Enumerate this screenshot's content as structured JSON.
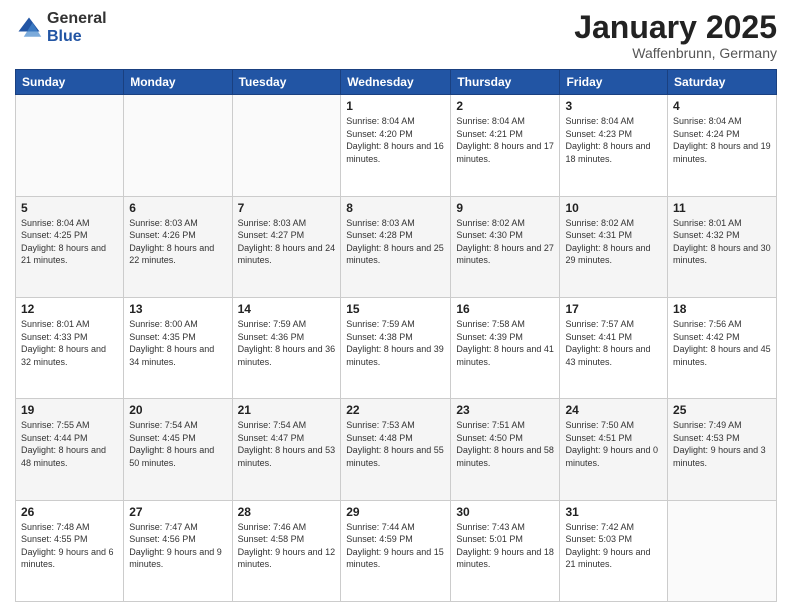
{
  "header": {
    "logo_general": "General",
    "logo_blue": "Blue",
    "month_title": "January 2025",
    "location": "Waffenbrunn, Germany"
  },
  "days_of_week": [
    "Sunday",
    "Monday",
    "Tuesday",
    "Wednesday",
    "Thursday",
    "Friday",
    "Saturday"
  ],
  "weeks": [
    [
      {
        "day": "",
        "info": ""
      },
      {
        "day": "",
        "info": ""
      },
      {
        "day": "",
        "info": ""
      },
      {
        "day": "1",
        "info": "Sunrise: 8:04 AM\nSunset: 4:20 PM\nDaylight: 8 hours\nand 16 minutes."
      },
      {
        "day": "2",
        "info": "Sunrise: 8:04 AM\nSunset: 4:21 PM\nDaylight: 8 hours\nand 17 minutes."
      },
      {
        "day": "3",
        "info": "Sunrise: 8:04 AM\nSunset: 4:23 PM\nDaylight: 8 hours\nand 18 minutes."
      },
      {
        "day": "4",
        "info": "Sunrise: 8:04 AM\nSunset: 4:24 PM\nDaylight: 8 hours\nand 19 minutes."
      }
    ],
    [
      {
        "day": "5",
        "info": "Sunrise: 8:04 AM\nSunset: 4:25 PM\nDaylight: 8 hours\nand 21 minutes."
      },
      {
        "day": "6",
        "info": "Sunrise: 8:03 AM\nSunset: 4:26 PM\nDaylight: 8 hours\nand 22 minutes."
      },
      {
        "day": "7",
        "info": "Sunrise: 8:03 AM\nSunset: 4:27 PM\nDaylight: 8 hours\nand 24 minutes."
      },
      {
        "day": "8",
        "info": "Sunrise: 8:03 AM\nSunset: 4:28 PM\nDaylight: 8 hours\nand 25 minutes."
      },
      {
        "day": "9",
        "info": "Sunrise: 8:02 AM\nSunset: 4:30 PM\nDaylight: 8 hours\nand 27 minutes."
      },
      {
        "day": "10",
        "info": "Sunrise: 8:02 AM\nSunset: 4:31 PM\nDaylight: 8 hours\nand 29 minutes."
      },
      {
        "day": "11",
        "info": "Sunrise: 8:01 AM\nSunset: 4:32 PM\nDaylight: 8 hours\nand 30 minutes."
      }
    ],
    [
      {
        "day": "12",
        "info": "Sunrise: 8:01 AM\nSunset: 4:33 PM\nDaylight: 8 hours\nand 32 minutes."
      },
      {
        "day": "13",
        "info": "Sunrise: 8:00 AM\nSunset: 4:35 PM\nDaylight: 8 hours\nand 34 minutes."
      },
      {
        "day": "14",
        "info": "Sunrise: 7:59 AM\nSunset: 4:36 PM\nDaylight: 8 hours\nand 36 minutes."
      },
      {
        "day": "15",
        "info": "Sunrise: 7:59 AM\nSunset: 4:38 PM\nDaylight: 8 hours\nand 39 minutes."
      },
      {
        "day": "16",
        "info": "Sunrise: 7:58 AM\nSunset: 4:39 PM\nDaylight: 8 hours\nand 41 minutes."
      },
      {
        "day": "17",
        "info": "Sunrise: 7:57 AM\nSunset: 4:41 PM\nDaylight: 8 hours\nand 43 minutes."
      },
      {
        "day": "18",
        "info": "Sunrise: 7:56 AM\nSunset: 4:42 PM\nDaylight: 8 hours\nand 45 minutes."
      }
    ],
    [
      {
        "day": "19",
        "info": "Sunrise: 7:55 AM\nSunset: 4:44 PM\nDaylight: 8 hours\nand 48 minutes."
      },
      {
        "day": "20",
        "info": "Sunrise: 7:54 AM\nSunset: 4:45 PM\nDaylight: 8 hours\nand 50 minutes."
      },
      {
        "day": "21",
        "info": "Sunrise: 7:54 AM\nSunset: 4:47 PM\nDaylight: 8 hours\nand 53 minutes."
      },
      {
        "day": "22",
        "info": "Sunrise: 7:53 AM\nSunset: 4:48 PM\nDaylight: 8 hours\nand 55 minutes."
      },
      {
        "day": "23",
        "info": "Sunrise: 7:51 AM\nSunset: 4:50 PM\nDaylight: 8 hours\nand 58 minutes."
      },
      {
        "day": "24",
        "info": "Sunrise: 7:50 AM\nSunset: 4:51 PM\nDaylight: 9 hours\nand 0 minutes."
      },
      {
        "day": "25",
        "info": "Sunrise: 7:49 AM\nSunset: 4:53 PM\nDaylight: 9 hours\nand 3 minutes."
      }
    ],
    [
      {
        "day": "26",
        "info": "Sunrise: 7:48 AM\nSunset: 4:55 PM\nDaylight: 9 hours\nand 6 minutes."
      },
      {
        "day": "27",
        "info": "Sunrise: 7:47 AM\nSunset: 4:56 PM\nDaylight: 9 hours\nand 9 minutes."
      },
      {
        "day": "28",
        "info": "Sunrise: 7:46 AM\nSunset: 4:58 PM\nDaylight: 9 hours\nand 12 minutes."
      },
      {
        "day": "29",
        "info": "Sunrise: 7:44 AM\nSunset: 4:59 PM\nDaylight: 9 hours\nand 15 minutes."
      },
      {
        "day": "30",
        "info": "Sunrise: 7:43 AM\nSunset: 5:01 PM\nDaylight: 9 hours\nand 18 minutes."
      },
      {
        "day": "31",
        "info": "Sunrise: 7:42 AM\nSunset: 5:03 PM\nDaylight: 9 hours\nand 21 minutes."
      },
      {
        "day": "",
        "info": ""
      }
    ]
  ]
}
